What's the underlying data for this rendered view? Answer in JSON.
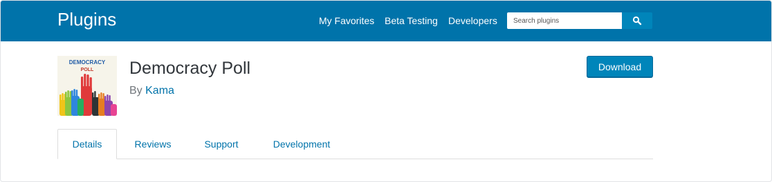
{
  "header": {
    "brand": "Plugins",
    "nav": [
      "My Favorites",
      "Beta Testing",
      "Developers"
    ],
    "search": {
      "placeholder": "Search plugins",
      "icon": "search-icon"
    }
  },
  "plugin": {
    "icon_text_line1": "DEMOCRACY",
    "icon_text_line2": "POLL",
    "title": "Democracy Poll",
    "by_label": "By",
    "author": "Kama",
    "download_label": "Download"
  },
  "tabs": [
    "Details",
    "Reviews",
    "Support",
    "Development"
  ],
  "active_tab": "Details",
  "colors": {
    "header_bg": "#0073aa",
    "accent": "#0085ba",
    "link": "#0073aa"
  }
}
